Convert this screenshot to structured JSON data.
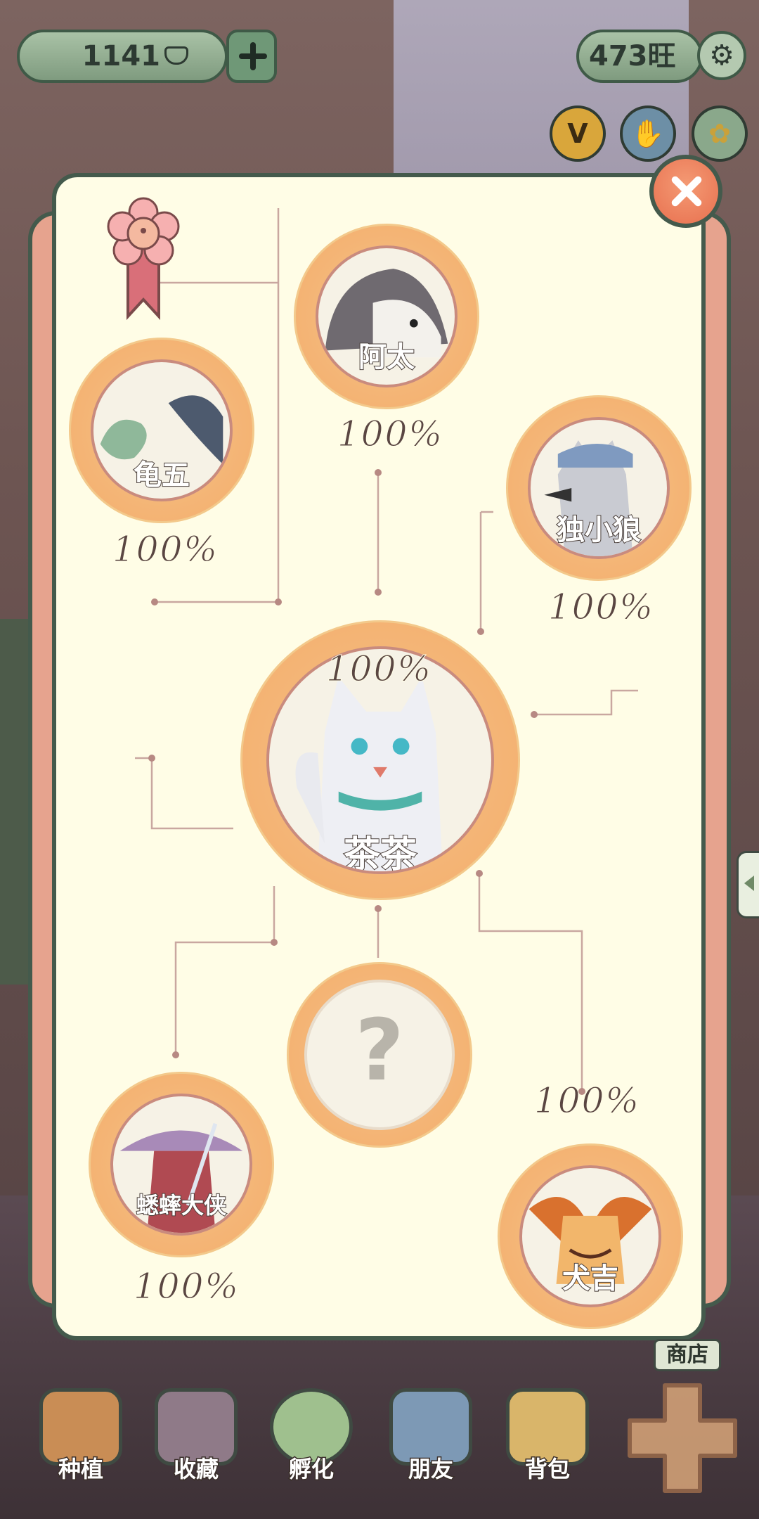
{
  "topbar": {
    "coins": "1141",
    "coin_icon": "ingot-icon",
    "add_icon": "plus-icon",
    "wang": "473旺",
    "settings_icon": "gear-icon",
    "round_buttons": [
      {
        "name": "vip-button",
        "label": "V"
      },
      {
        "name": "hand-button",
        "label": "✋"
      },
      {
        "name": "ginkgo-button",
        "label": "✿"
      }
    ]
  },
  "panel": {
    "close_icon": "close-icon",
    "badge_icon": "flower-ribbon-icon",
    "characters": [
      {
        "id": "guiwu",
        "name": "龟五",
        "percent": "100%"
      },
      {
        "id": "atai",
        "name": "阿太",
        "percent": "100%"
      },
      {
        "id": "duxiaolang",
        "name": "独小狼",
        "percent": "100%"
      },
      {
        "id": "chacha",
        "name": "茶茶",
        "percent": "100%"
      },
      {
        "id": "unknown",
        "name": "?",
        "percent": ""
      },
      {
        "id": "xishuai",
        "name": "蟋蟀大侠",
        "percent": "100%"
      },
      {
        "id": "quanji",
        "name": "犬吉",
        "percent": "100%"
      }
    ]
  },
  "side_tab_icon": "triangle-left-icon",
  "shop_label": "商店",
  "bottom_nav": [
    {
      "label": "种植",
      "icon": "sprout-basket-icon",
      "color": "#c98d55"
    },
    {
      "label": "收藏",
      "icon": "book-icon",
      "color": "#8f7a88"
    },
    {
      "label": "孵化",
      "icon": "egg-icon",
      "color": "#9fc08e"
    },
    {
      "label": "朋友",
      "icon": "cat-icon",
      "color": "#7d99b5"
    },
    {
      "label": "背包",
      "icon": "basket-icon",
      "color": "#d9b56a"
    }
  ],
  "colors": {
    "panel_bg": "#fffde6",
    "panel_border": "#445a4c",
    "node_ring": "#f4b576",
    "close_button": "#e8704f"
  }
}
